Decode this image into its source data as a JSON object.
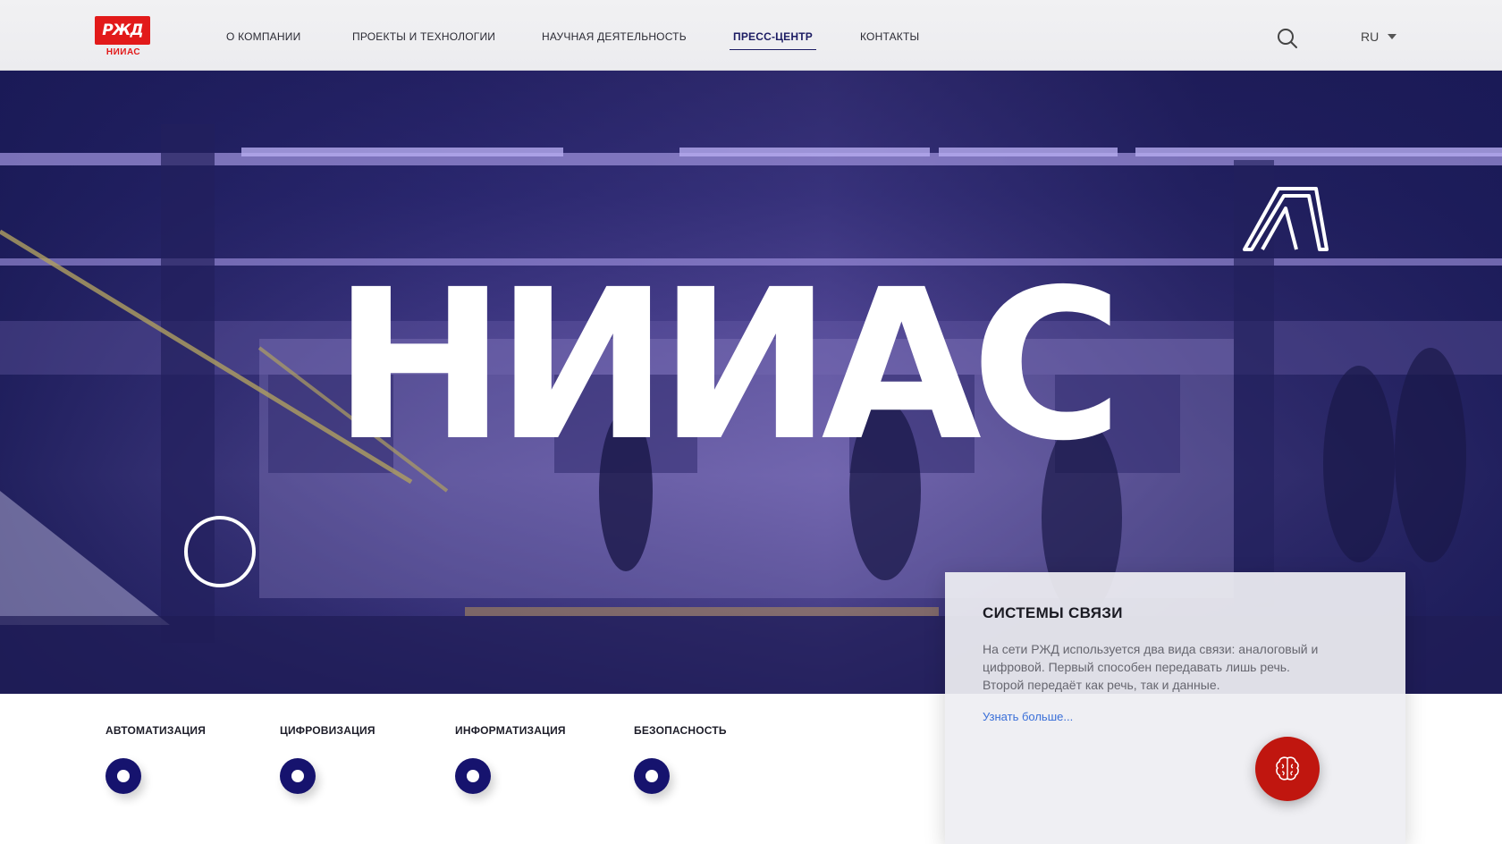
{
  "header": {
    "logo": {
      "mark": "РЖД",
      "subtitle": "НИИАС"
    },
    "nav": [
      {
        "label": "О КОМПАНИИ",
        "active": false
      },
      {
        "label": "ПРОЕКТЫ И ТЕХНОЛОГИИ",
        "active": false
      },
      {
        "label": "НАУЧНАЯ ДЕЯТЕЛЬНОСТЬ",
        "active": false
      },
      {
        "label": "ПРЕСС-ЦЕНТР",
        "active": true
      },
      {
        "label": "КОНТАКТЫ",
        "active": false
      }
    ],
    "search_icon": "search-icon",
    "language": "RU"
  },
  "hero": {
    "title": "НИИАС",
    "background": "subway-station-photo"
  },
  "categories": [
    {
      "label": "АВТОМАТИЗАЦИЯ"
    },
    {
      "label": "ЦИФРОВИЗАЦИЯ"
    },
    {
      "label": "ИНФОРМАТИЗАЦИЯ"
    },
    {
      "label": "БЕЗОПАСНОСТЬ"
    }
  ],
  "card": {
    "title": "СИСТЕМЫ СВЯЗИ",
    "text": "На сети РЖД используется два вида связи: аналоговый и цифровой. Первый способен передавать лишь речь. Второй передаёт как речь, так и данные.",
    "link": "Узнать больше..."
  },
  "fab": {
    "icon": "brain-icon"
  },
  "colors": {
    "brand_red": "#e21a1a",
    "navy": "#16136e",
    "link_blue": "#3a6fd8",
    "fab_red": "#c0160f"
  }
}
